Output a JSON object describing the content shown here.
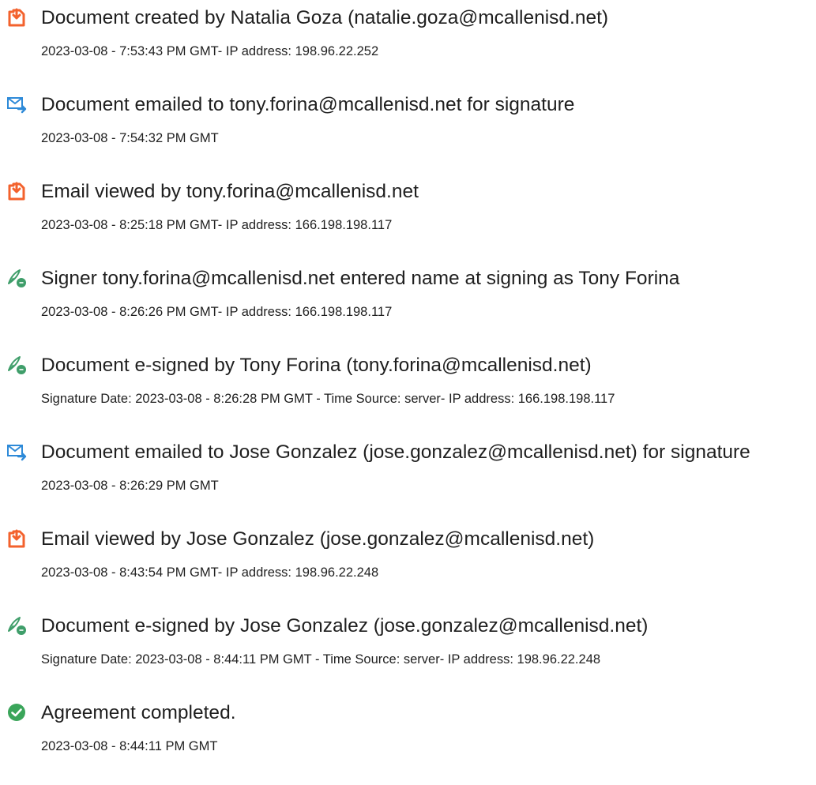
{
  "colors": {
    "document_icon": "#f3622d",
    "email_icon": "#2e8ad8",
    "sign_icon": "#3f9e6a",
    "complete_icon": "#3aa55a",
    "text": "#1f1f1f"
  },
  "entries": [
    {
      "icon": "document-icon",
      "title": "Document created by Natalia Goza (natalie.goza@mcallenisd.net)",
      "detail": "2023-03-08 - 7:53:43 PM GMT- IP address: 198.96.22.252"
    },
    {
      "icon": "email-icon",
      "title": "Document emailed to tony.forina@mcallenisd.net for signature",
      "detail": "2023-03-08 - 7:54:32 PM GMT"
    },
    {
      "icon": "document-icon",
      "title": "Email viewed by tony.forina@mcallenisd.net",
      "detail": "2023-03-08 - 8:25:18 PM GMT- IP address: 166.198.198.117"
    },
    {
      "icon": "e-sign-icon",
      "title": "Signer tony.forina@mcallenisd.net entered name at signing as Tony Forina",
      "detail": "2023-03-08 - 8:26:26 PM GMT- IP address: 166.198.198.117"
    },
    {
      "icon": "e-sign-icon",
      "title": "Document e-signed by Tony Forina (tony.forina@mcallenisd.net)",
      "detail": "Signature Date: 2023-03-08 - 8:26:28 PM GMT - Time Source: server- IP address: 166.198.198.117"
    },
    {
      "icon": "email-icon",
      "title": "Document emailed to Jose Gonzalez (jose.gonzalez@mcallenisd.net) for signature",
      "detail": "2023-03-08 - 8:26:29 PM GMT"
    },
    {
      "icon": "document-icon",
      "title": "Email viewed by Jose Gonzalez (jose.gonzalez@mcallenisd.net)",
      "detail": "2023-03-08 - 8:43:54 PM GMT- IP address: 198.96.22.248"
    },
    {
      "icon": "e-sign-icon",
      "title": "Document e-signed by Jose Gonzalez (jose.gonzalez@mcallenisd.net)",
      "detail": "Signature Date: 2023-03-08 - 8:44:11 PM GMT - Time Source: server- IP address: 198.96.22.248"
    },
    {
      "icon": "checkmark-circle-icon",
      "title": "Agreement completed.",
      "detail": "2023-03-08 - 8:44:11 PM GMT"
    }
  ]
}
